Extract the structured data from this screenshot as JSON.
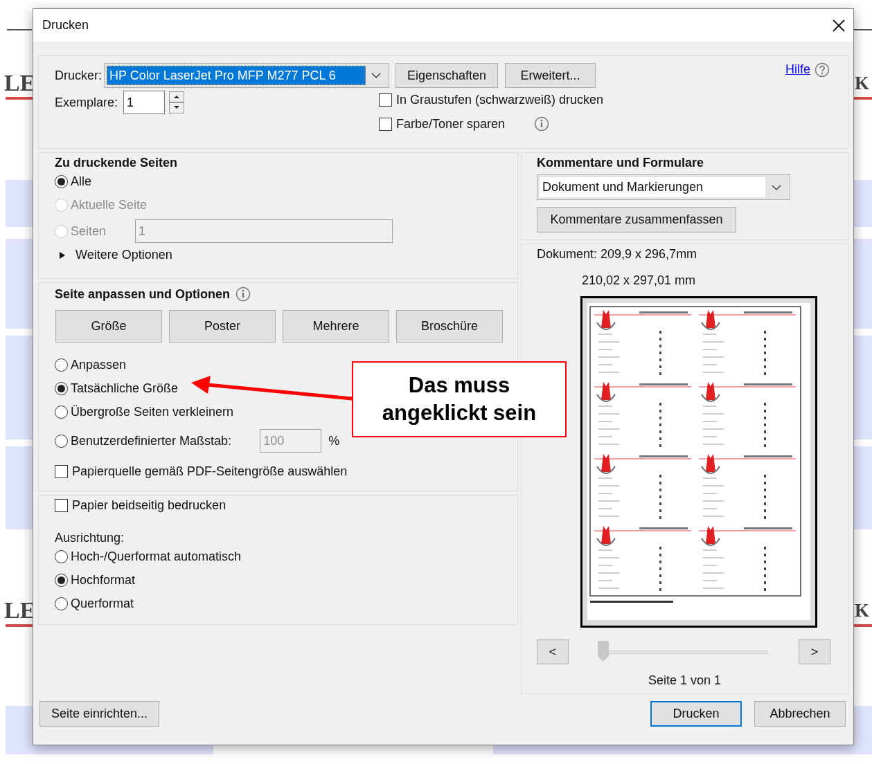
{
  "background": {
    "left_texts": [
      "LE",
      "LE"
    ],
    "right_texts": [
      "K",
      "K"
    ]
  },
  "window": {
    "title": "Drucken"
  },
  "printer": {
    "label": "Drucker:",
    "value": "HP Color LaserJet Pro MFP M277 PCL 6",
    "buttons": [
      "Eigenschaften",
      "Erweitert..."
    ]
  },
  "help": {
    "label": "Hilfe"
  },
  "copies": {
    "label": "Exemplare:",
    "value": "1"
  },
  "options": [
    {
      "label": "In Graustufen (schwarzweiß) drucken",
      "checked": false,
      "info": false
    },
    {
      "label": "Farbe/Toner sparen",
      "checked": false,
      "info": true
    }
  ],
  "pages_section": {
    "title": "Zu druckende Seiten",
    "radios": [
      {
        "label": "Alle",
        "selected": true,
        "disabled": false
      },
      {
        "label": "Aktuelle Seite",
        "selected": false,
        "disabled": true
      },
      {
        "label": "Seiten",
        "selected": false,
        "disabled": true,
        "value": "1"
      }
    ],
    "more": {
      "label": "Weitere Optionen",
      "expanded": false
    }
  },
  "fit_section": {
    "title": "Seite anpassen und Optionen",
    "buttons": [
      "Größe",
      "Poster",
      "Mehrere",
      "Broschüre"
    ],
    "radios": [
      {
        "label": "Anpassen",
        "selected": false
      },
      {
        "label": "Tatsächliche Größe",
        "selected": true
      },
      {
        "label": "Übergroße Seiten verkleinern",
        "selected": false
      },
      {
        "label": "Benutzerdefinierter Maßstab:",
        "selected": false,
        "value": "100",
        "unit": "%"
      }
    ],
    "paper_source": {
      "label": "Papierquelle gemäß PDF-Seitengröße auswählen",
      "checked": false
    }
  },
  "duplex": {
    "label": "Papier beidseitig bedrucken",
    "checked": false
  },
  "orientation": {
    "label": "Ausrichtung:",
    "radios": [
      {
        "label": "Hoch-/Querformat automatisch",
        "selected": false
      },
      {
        "label": "Hochformat",
        "selected": true
      },
      {
        "label": "Querformat",
        "selected": false
      }
    ]
  },
  "comments": {
    "title": "Kommentare und Formulare",
    "value": "Dokument und Markierungen",
    "button": "Kommentare zusammenfassen"
  },
  "preview": {
    "document": "Dokument: 209,9 x 296,7mm",
    "paper": "210,02 x 297,01 mm",
    "prev": "<",
    "next": ">",
    "level": 0,
    "page": "Seite 1 von 1"
  },
  "footer": {
    "setup": "Seite einrichten...",
    "print": "Drucken",
    "cancel": "Abbrechen"
  },
  "annotation": {
    "text": "Das muss angeklickt sein"
  }
}
